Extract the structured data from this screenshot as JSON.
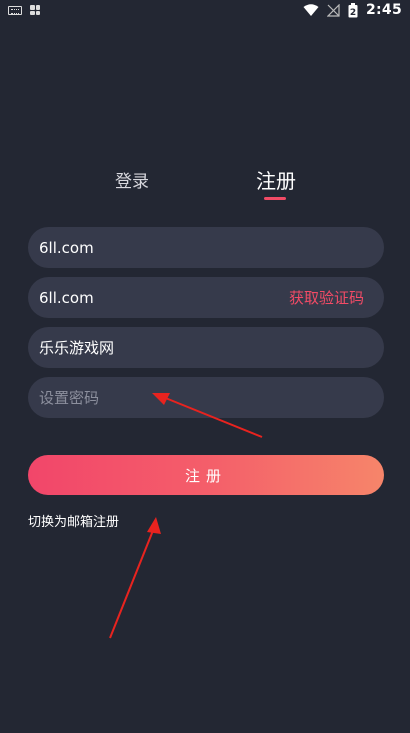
{
  "status_bar": {
    "time": "2:45",
    "battery_level": "2",
    "icons": [
      "keyboard-icon",
      "app-grid-icon",
      "wifi-icon",
      "no-signal-icon",
      "battery-icon"
    ]
  },
  "tabs": {
    "login_label": "登录",
    "register_label": "注册",
    "active": "register"
  },
  "form": {
    "account_value": "6ll.com",
    "code_value": "6ll.com",
    "get_code_label": "获取验证码",
    "nickname_value": "乐乐游戏网",
    "password_placeholder": "设置密码"
  },
  "submit_label": "注册",
  "switch_label": "切换为邮箱注册",
  "colors": {
    "background": "#232733",
    "field": "#363a4b",
    "accent": "#f24b66",
    "button_gradient": [
      "#f2466a",
      "#f6856a"
    ],
    "annotation_arrow": "#e8231f"
  }
}
